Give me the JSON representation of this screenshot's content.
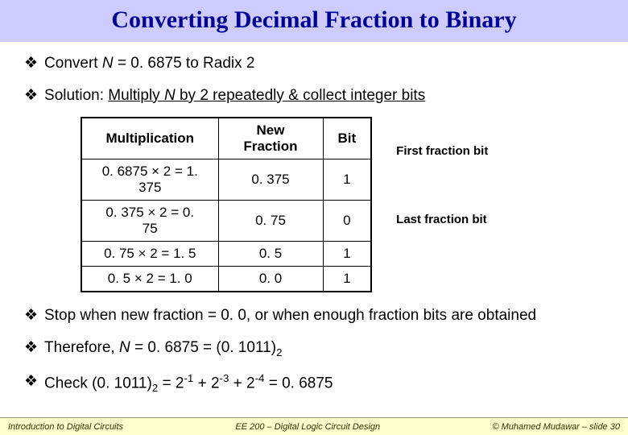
{
  "title": "Converting Decimal Fraction to Binary",
  "bullets": {
    "b1_pre": "Convert ",
    "b1_var": "N",
    "b1_post": " = 0. 6875 to Radix 2",
    "b2_pre": "Solution: ",
    "b2_u": "Multiply ",
    "b2_uvar": "N",
    "b2_upost": " by 2 repeatedly & collect integer bits",
    "b3": "Stop when new fraction = 0. 0, or when enough fraction bits are obtained",
    "b4_pre": "Therefore, ",
    "b4_var": "N",
    "b4_eq": " = 0. 6875 = (0. 1011)",
    "b4_sub": "2",
    "b5_pre": "Check (0. 1011)",
    "b5_sub1": "2",
    "b5_mid1": " = 2",
    "b5_sup1": "-1",
    "b5_mid2": " + 2",
    "b5_sup2": "-3",
    "b5_mid3": " + 2",
    "b5_sup3": "-4",
    "b5_end": " = 0. 6875"
  },
  "table": {
    "headers": {
      "h1": "Multiplication",
      "h2": "New Fraction",
      "h3": "Bit"
    },
    "rows": [
      {
        "mult": "0. 6875 × 2 = 1. 375",
        "frac": "0. 375",
        "bit": "1"
      },
      {
        "mult": "0. 375 × 2 = 0. 75",
        "frac": "0. 75",
        "bit": "0"
      },
      {
        "mult": "0. 75 × 2 = 1. 5",
        "frac": "0. 5",
        "bit": "1"
      },
      {
        "mult": "0. 5 × 2 = 1. 0",
        "frac": "0. 0",
        "bit": "1"
      }
    ]
  },
  "annotations": {
    "first": "First fraction bit",
    "last": "Last fraction bit"
  },
  "footer": {
    "left": "Introduction to Digital Circuits",
    "center": "EE 200 – Digital Logic Circuit Design",
    "right": "© Muhamed Mudawar – slide 30"
  }
}
